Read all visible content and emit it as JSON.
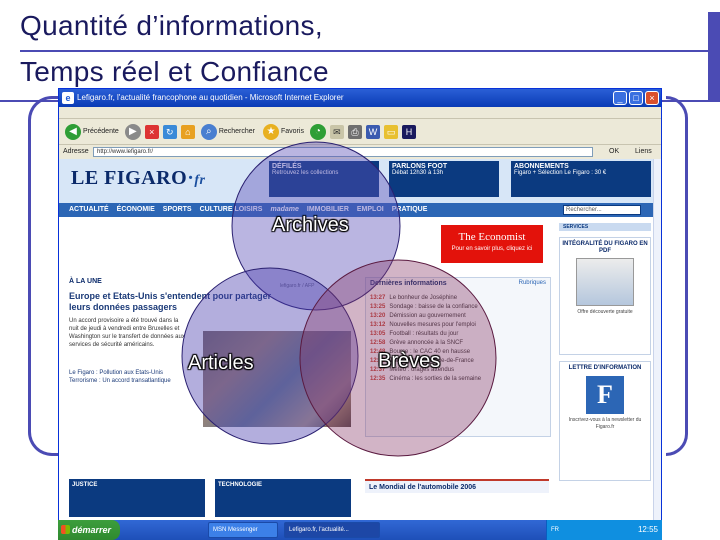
{
  "slide": {
    "title_line1": "Quantité d’informations,",
    "title_line2": "Temps réel et Confiance"
  },
  "venn": {
    "circles": [
      {
        "label": "Archives",
        "color": "#5b4fb8"
      },
      {
        "label": "Articles",
        "color": "#4b3fae"
      },
      {
        "label": "Brèves",
        "color": "#8a3a6a"
      }
    ]
  },
  "browser": {
    "title": "Lefigaro.fr, l'actualité francophone au quotidien - Microsoft Internet Explorer",
    "toolbar": {
      "back_label": "Précédente",
      "search_label": "Rechercher",
      "favorites_label": "Favoris"
    },
    "address_label": "Adresse",
    "address_value": "http://www.lefigaro.fr/",
    "go_label": "OK",
    "links_label": "Liens"
  },
  "figaro": {
    "logo": "LE FIGARO",
    "logo_suffix": "fr",
    "promo_defiles": {
      "title": "DÉFILÉS",
      "text": "Retrouvez les collections"
    },
    "promo_foot": {
      "title": "PARLONS FOOT",
      "text": "Débat 12h30 à 13h"
    },
    "promo_abonnement": {
      "title": "ABONNEMENTS",
      "text": "Figaro + Sélection Le Figaro : 30 €"
    },
    "nav": [
      "ACTUALITÉ",
      "ÉCONOMIE",
      "SPORTS",
      "CULTURE LOISIRS",
      "madame",
      "IMMOBILIER",
      "EMPLOI",
      "PRATIQUE"
    ],
    "search_placeholder": "Rechercher...",
    "economist_name": "The Economist",
    "economist_tagline": "Pour en savoir plus, cliquez ici",
    "section_head": "À LA UNE",
    "photo_credit": "lefigaro.fr / AFP",
    "headline": "Europe et Etats-Unis s'entendent pour partager leurs données passagers",
    "body": "Un accord provisoire a été trouvé dans la nuit de jeudi à vendredi entre Bruxelles et Washington sur le transfert de données aux services de sécurité américains.",
    "body_links": [
      "Le Figaro : Pollution aux Etats-Unis",
      "Terrorisme : Un accord transatlantique"
    ],
    "breves_title": "Dernières informations",
    "breves_extra": "Rubriques",
    "breves": [
      {
        "time": "13:27",
        "text": "Le bonheur de Joséphine"
      },
      {
        "time": "13:25",
        "text": "Sondage : baisse de la confiance"
      },
      {
        "time": "13:20",
        "text": "Démission au gouvernement"
      },
      {
        "time": "13:12",
        "text": "Nouvelles mesures pour l'emploi"
      },
      {
        "time": "13:05",
        "text": "Football : résultats du jour"
      },
      {
        "time": "12:58",
        "text": "Grève annoncée à la SNCF"
      },
      {
        "time": "12:48",
        "text": "Bourse : le CAC 40 en hausse"
      },
      {
        "time": "12:43",
        "text": "Trafic perturbé en Ile-de-France"
      },
      {
        "time": "12:37",
        "text": "Météo : orages attendus"
      },
      {
        "time": "12:35",
        "text": "Cinéma : les sorties de la semaine"
      }
    ],
    "bottom_justice": "JUSTICE",
    "bottom_techno": "TECHNOLOGIE",
    "mondial": "Le Mondial de l'automobile 2006",
    "sidebar": {
      "services": "SERVICES",
      "integral_title": "INTÉGRALITÉ DU FIGARO EN PDF",
      "integral_caption": "Offre découverte gratuite",
      "lettre_title": "LETTRE D'INFORMATION",
      "lettre_caption": "Inscrivez-vous à la newsletter du Figaro.fr"
    }
  },
  "taskbar": {
    "start_label": "démarrer",
    "items": [
      "MSN Messenger",
      "Lefigaro.fr, l'actualité..."
    ],
    "lang": "FR",
    "clock": "12:55"
  }
}
